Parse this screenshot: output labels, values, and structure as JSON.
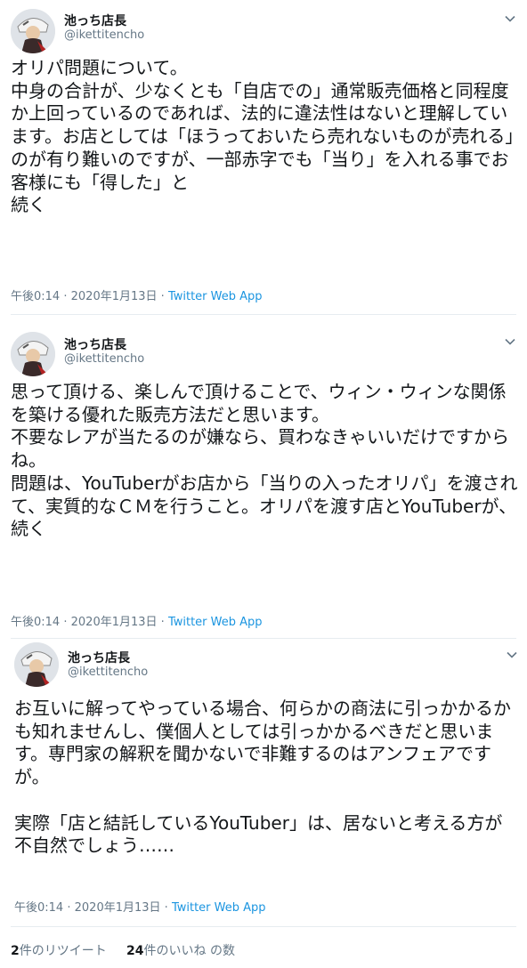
{
  "tweets": [
    {
      "name": "池っち店長",
      "handle": "@ikettitencho",
      "text": "オリパ問題について。\n中身の合計が、少なくとも「自店での」通常販売価格と同程度か上回っているのであれば、法的に違法性はないと理解しています。お店としては「ほうっておいたら売れないものが売れる」のが有り難いのですが、一部赤字でも「当り」を入れる事でお客様にも「得した」と\n続く",
      "time": "午後0:14",
      "date": "2020年1月13日",
      "sep": "·",
      "app": "Twitter Web App"
    },
    {
      "name": "池っち店長",
      "handle": "@ikettitencho",
      "text": "思って頂ける、楽しんで頂けることで、ウィン・ウィンな関係を築ける優れた販売方法だと思います。\n不要なレアが当たるのが嫌なら、買わなきゃいいだけですからね。\n問題は、YouTuberがお店から「当りの入ったオリパ」を渡されて、実質的なＣＭを行うこと。オリパを渡す店とYouTuberが、\n続く",
      "time": "午後0:14",
      "date": "2020年1月13日",
      "sep": "·",
      "app": "Twitter Web App"
    },
    {
      "name": "池っち店長",
      "handle": "@ikettitencho",
      "text": "お互いに解ってやっている場合、何らかの商法に引っかかるかも知れませんし、僕個人としては引っかかるべきだと思います。専門家の解釈を聞かないで非難するのはアンフェアですが。\n\n実際「店と結託しているYouTuber」は、居ないと考える方が不自然でしょう……",
      "time": "午後0:14",
      "date": "2020年1月13日",
      "sep": "·",
      "app": "Twitter Web App"
    }
  ],
  "stats": {
    "retweets_count": "2",
    "retweets_label": "件のリツイート",
    "likes_count": "24",
    "likes_label": "件のいいね の数"
  },
  "colors": {
    "text": "#14171a",
    "muted": "#657786",
    "link": "#1b95e0",
    "divider": "#e6ecf0"
  },
  "icons": [
    "avatar",
    "chevron-down-icon"
  ]
}
